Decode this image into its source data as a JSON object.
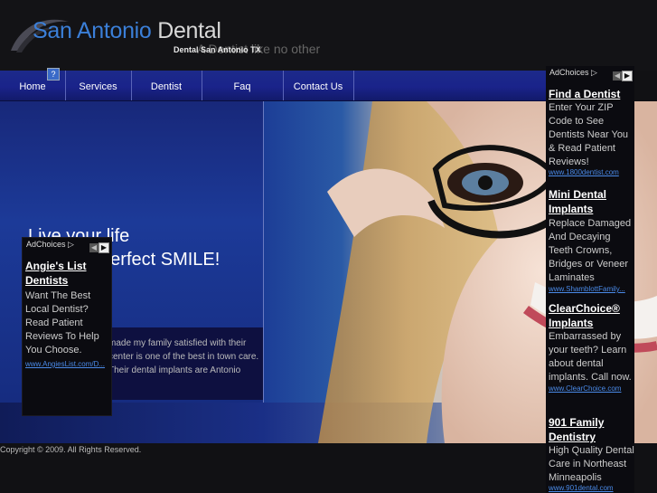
{
  "header": {
    "logo_part1": "San Antonio",
    "logo_part2": " Dental",
    "tagline_big": "A Dentist like no other",
    "tagline_small": "Dental San Antonio TX"
  },
  "nav": {
    "help": "?",
    "items": [
      {
        "label": "Home"
      },
      {
        "label": "Services"
      },
      {
        "label": "Dentist"
      },
      {
        "label": "Faq"
      },
      {
        "label": "Contact Us"
      }
    ]
  },
  "hero": {
    "headline_line1": "Live your life",
    "headline_line2": "with that perfect SMILE!",
    "testimonial": "made my family satisfied with their center is one of the best in town care. Their dental implants are Antonio"
  },
  "left_ad": {
    "adchoices": "AdChoices",
    "title": "Angie's List Dentists",
    "body": "Want The Best Local Dentist? Read Patient Reviews To Help You Choose.",
    "url": "www.AngiesList.com/D..."
  },
  "right_ads": {
    "adchoices": "AdChoices",
    "items": [
      {
        "title": "Find a Dentist",
        "body": "Enter Your ZIP Code to See Dentists Near You & Read Patient Reviews!",
        "url": "www.1800dentist.com"
      },
      {
        "title": "Mini Dental Implants",
        "body": "Replace Damaged And Decaying Teeth Crowns, Bridges or Veneer Laminates",
        "url": "www.ShamblottFamily..."
      },
      {
        "title": "ClearChoice® Implants",
        "body": "Embarrassed by your teeth? Learn about dental implants. Call now.",
        "url": "www.ClearChoice.com"
      },
      {
        "title": "901 Family Dentistry",
        "body": "High Quality Dental Care in Northeast Minneapolis",
        "url": "www.901dental.com"
      }
    ]
  },
  "footer": {
    "copyright": "Copyright © 2009. All Rights Reserved."
  },
  "colors": {
    "nav_bg": "#1a238a",
    "logo_blue": "#3b7fd8",
    "link_blue": "#4a8ae8"
  }
}
